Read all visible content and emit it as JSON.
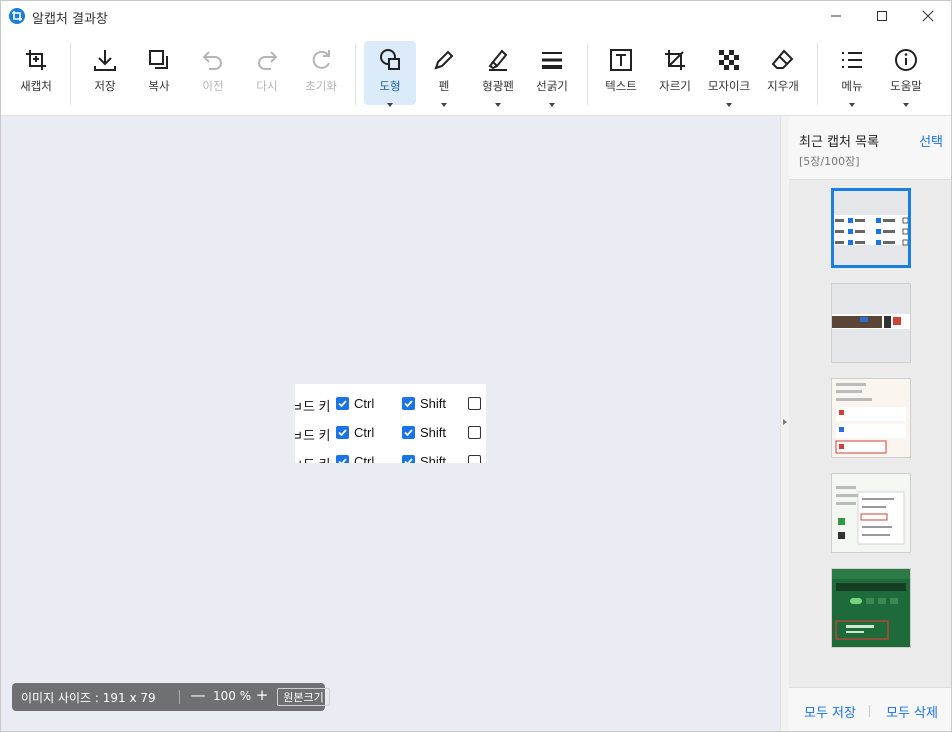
{
  "window": {
    "title": "알캡처 결과창",
    "icons": {
      "app": "crop-icon",
      "minimize": "minimize-icon",
      "maximize": "maximize-icon",
      "close": "close-icon"
    }
  },
  "toolbar": {
    "new_capture": "새캡처",
    "save": "저장",
    "copy": "복사",
    "undo": "이전",
    "redo": "다시",
    "reset": "초기화",
    "shape": "도형",
    "pen": "펜",
    "highlighter": "형광펜",
    "line_width": "선굵기",
    "text": "텍스트",
    "crop": "자르기",
    "mosaic": "모자이크",
    "eraser": "지우개",
    "menu": "메뉴",
    "help": "도움말"
  },
  "capture": {
    "rows": [
      {
        "key": "ㅂ드 키",
        "ctrl": "Ctrl",
        "shift": "Shift"
      },
      {
        "key": "ㅂ드 키",
        "ctrl": "Ctrl",
        "shift": "Shift"
      },
      {
        "key": "ㅂ드 키",
        "ctrl": "Ctrl",
        "shift": "Shift"
      }
    ]
  },
  "status": {
    "image_size": "이미지 사이즈 : 191 x 79",
    "zoom_out": "—",
    "zoom_level": "100 %",
    "zoom_in": "+",
    "original_size": "원본크기"
  },
  "panel": {
    "title": "최근 캡처 목록",
    "select": "선택",
    "count": "[5장/100장]",
    "save_all": "모두 저장",
    "delete_all": "모두 삭제"
  },
  "colors": {
    "accent": "#1a7fe0",
    "canvas_bg": "#e9ecf2",
    "checkbox": "#1a73e8"
  }
}
